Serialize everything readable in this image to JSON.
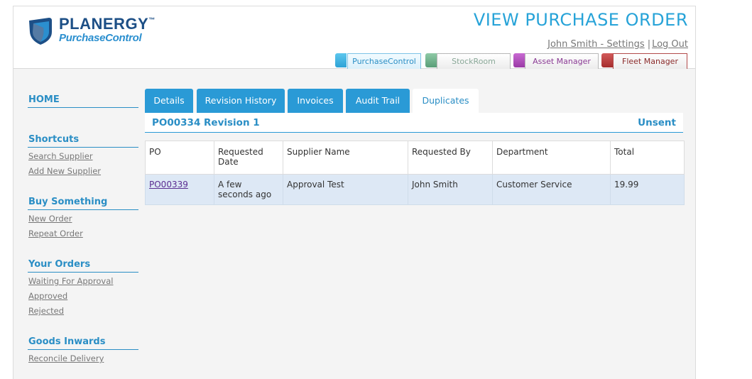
{
  "logo": {
    "name": "PLANERGY",
    "tm": "™",
    "sub": "PurchaseControl"
  },
  "page_title": "VIEW PURCHASE ORDER",
  "user": {
    "name_settings": "John Smith - Settings",
    "separator": "|",
    "logout": "Log Out"
  },
  "apps": [
    {
      "label": "PurchaseControl"
    },
    {
      "label": "StockRoom"
    },
    {
      "label": "Asset Manager"
    },
    {
      "label": "Fleet Manager"
    }
  ],
  "sidebar": {
    "home": "HOME",
    "shortcuts": {
      "heading": "Shortcuts",
      "items": [
        "Search Supplier",
        "Add New Supplier"
      ]
    },
    "buy": {
      "heading": "Buy Something",
      "items": [
        "New Order",
        "Repeat Order"
      ]
    },
    "orders": {
      "heading": "Your Orders",
      "items": [
        "Waiting For Approval",
        "Approved",
        "Rejected"
      ]
    },
    "goods": {
      "heading": "Goods Inwards",
      "items": [
        "Reconcile Delivery"
      ]
    }
  },
  "tabs": [
    "Details",
    "Revision History",
    "Invoices",
    "Audit Trail",
    "Duplicates"
  ],
  "po": {
    "title": "PO00334 Revision 1",
    "status": "Unsent"
  },
  "table": {
    "headers": [
      "PO",
      "Requested Date",
      "Supplier Name",
      "Requested By",
      "Department",
      "Total"
    ],
    "rows": [
      {
        "po": "PO00339",
        "requested_date": "A few seconds ago",
        "supplier": "Approval Test",
        "requested_by": "John Smith",
        "department": "Customer Service",
        "total": "19.99"
      }
    ]
  },
  "colors": {
    "accent": "#2a9ad6",
    "title": "#27a3d8",
    "row_highlight": "#dde8f5"
  }
}
